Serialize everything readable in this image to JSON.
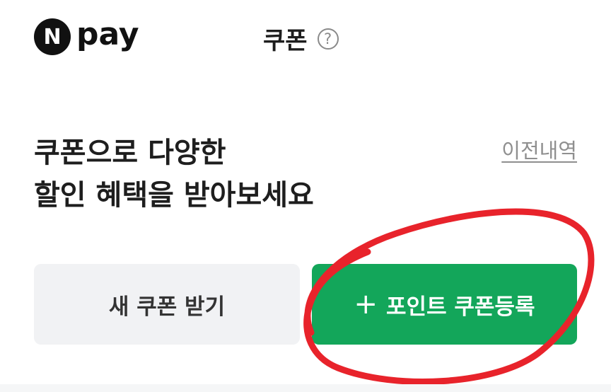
{
  "header": {
    "logo_badge": "N",
    "logo_text": "pay",
    "title": "쿠폰",
    "help_icon": "question-circle-icon"
  },
  "main": {
    "headline_line1": "쿠폰으로 다양한",
    "headline_line2": "할인 혜택을 받아보세요",
    "history_link": "이전내역",
    "receive_button": "새 쿠폰 받기",
    "register_button_icon": "+",
    "register_button": "포인트 쿠폰등록"
  },
  "colors": {
    "accent_green": "#13a65a",
    "secondary_button_bg": "#f1f2f4",
    "annotation_red": "#e8232b"
  }
}
